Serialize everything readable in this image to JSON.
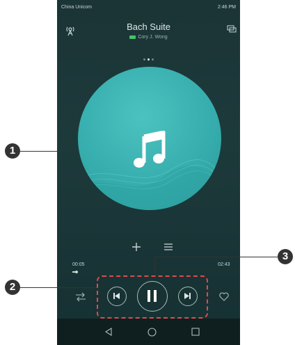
{
  "status_bar": {
    "carrier": "China Unicom",
    "system": "2:46 PM"
  },
  "header": {
    "title": "Bach Suite",
    "artist": "Cory J. Wong",
    "left_icon": "broadcast-icon",
    "right_icon": "switch-screen-icon"
  },
  "album_art": {
    "icon": "music-note-icon"
  },
  "actions": {
    "add_icon": "plus-icon",
    "list_icon": "playlist-icon"
  },
  "progress": {
    "elapsed": "00:05",
    "total": "02:43",
    "fraction": 0.03
  },
  "controls": {
    "mode_icon": "play-mode-icon",
    "prev_icon": "previous-icon",
    "play_pause_icon": "pause-icon",
    "next_icon": "next-icon",
    "favorite_icon": "heart-icon"
  },
  "nav_bar": {
    "back_icon": "back-icon",
    "home_icon": "home-icon",
    "recent_icon": "recent-apps-icon"
  },
  "callouts": [
    "1",
    "2",
    "3"
  ],
  "colors": {
    "highlight": "#e24b4b",
    "album_teal": "#37aeae",
    "background": "#1b3436"
  }
}
